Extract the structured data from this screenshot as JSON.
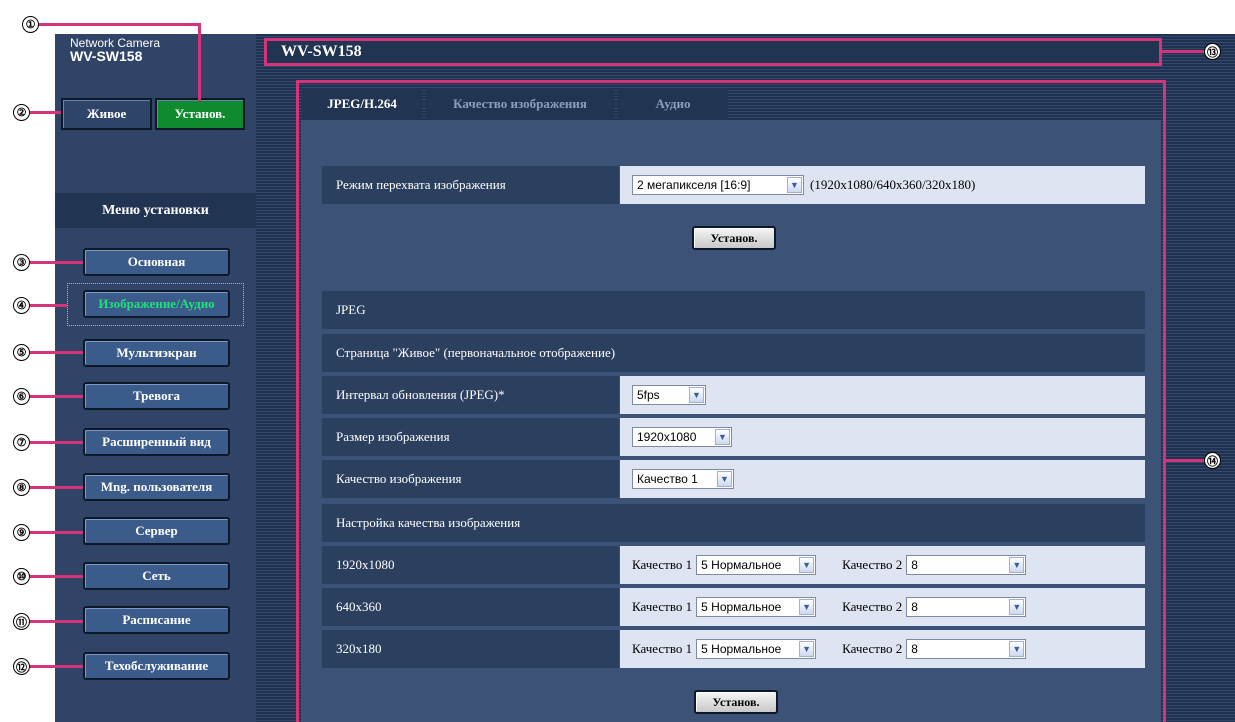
{
  "brand": {
    "line1": "Network Camera",
    "line2": "WV-SW158"
  },
  "top_buttons": {
    "live": "Живое",
    "setup": "Установ."
  },
  "menu": {
    "title": "Меню установки",
    "items": [
      "Основная",
      "Изображение/Аудио",
      "Мультиэкран",
      "Тревога",
      "Расширенный вид",
      "Mng. пользователя",
      "Сервер",
      "Сеть",
      "Расписание",
      "Техобслуживание"
    ],
    "active_index": 1
  },
  "header": {
    "title": "WV-SW158"
  },
  "tabs": [
    {
      "label": "JPEG/H.264",
      "selected": true
    },
    {
      "label": "Качество изображения",
      "selected": false
    },
    {
      "label": "Аудио",
      "selected": false
    }
  ],
  "capture_mode": {
    "label": "Режим перехвата изображения",
    "value": "2 мегапикселя [16:9]",
    "info": "(1920x1080/640x360/320x180)"
  },
  "set_button": "Установ.",
  "jpeg": {
    "section_title": "JPEG",
    "live_page_title": "Страница \"Живое\" (первоначальное отображение)",
    "refresh": {
      "label": "Интервал обновления (JPEG)*",
      "value": "5fps"
    },
    "size": {
      "label": "Размер изображения",
      "value": "1920x1080"
    },
    "quality": {
      "label": "Качество изображения",
      "value": "Качество 1"
    }
  },
  "quality_settings": {
    "title": "Настройка качества изображения",
    "q1_label": "Качество 1",
    "q2_label": "Качество 2",
    "rows": [
      {
        "resolution": "1920x1080",
        "q1": "5 Нормальное",
        "q2": "8"
      },
      {
        "resolution": "640x360",
        "q1": "5 Нормальное",
        "q2": "8"
      },
      {
        "resolution": "320x180",
        "q1": "5 Нормальное",
        "q2": "8"
      }
    ]
  },
  "callouts": [
    "①",
    "②",
    "③",
    "④",
    "⑤",
    "⑥",
    "⑦",
    "⑧",
    "⑨",
    "⑩",
    "⑪",
    "⑫",
    "⑬",
    "⑭"
  ],
  "colors": {
    "accent": "#d6347a",
    "active_text": "#22e07a",
    "setup_green": "#0f8a2e"
  }
}
